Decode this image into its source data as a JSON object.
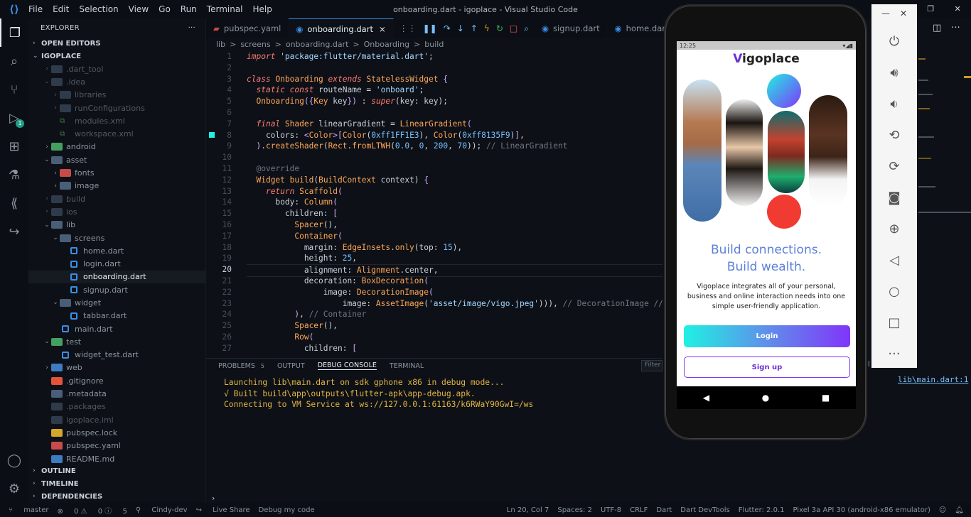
{
  "window": {
    "title": "onboarding.dart - igoplace - Visual Studio Code",
    "menu": [
      "File",
      "Edit",
      "Selection",
      "View",
      "Go",
      "Run",
      "Terminal",
      "Help"
    ]
  },
  "activity": {
    "debug_badge": "1"
  },
  "sidebar": {
    "header": "EXPLORER",
    "open_editors": "OPEN EDITORS",
    "root": "IGOPLACE",
    "items": [
      {
        "label": ".dart_tool",
        "depth": 1,
        "kind": "folder",
        "dim": true
      },
      {
        "label": ".idea",
        "depth": 1,
        "kind": "folder",
        "dim": true,
        "open": true
      },
      {
        "label": "libraries",
        "depth": 2,
        "kind": "folder",
        "dim": true
      },
      {
        "label": "runConfigurations",
        "depth": 2,
        "kind": "folder",
        "dim": true
      },
      {
        "label": "modules.xml",
        "depth": 2,
        "kind": "xml",
        "dim": true
      },
      {
        "label": "workspace.xml",
        "depth": 2,
        "kind": "xml",
        "dim": true
      },
      {
        "label": "android",
        "depth": 1,
        "kind": "folder-g"
      },
      {
        "label": "asset",
        "depth": 1,
        "kind": "folder",
        "open": true
      },
      {
        "label": "fonts",
        "depth": 2,
        "kind": "folder-r"
      },
      {
        "label": "image",
        "depth": 2,
        "kind": "folder"
      },
      {
        "label": "build",
        "depth": 1,
        "kind": "folder",
        "dim": true
      },
      {
        "label": "ios",
        "depth": 1,
        "kind": "folder",
        "dim": true
      },
      {
        "label": "lib",
        "depth": 1,
        "kind": "folder",
        "open": true
      },
      {
        "label": "screens",
        "depth": 2,
        "kind": "folder",
        "open": true
      },
      {
        "label": "home.dart",
        "depth": 3,
        "kind": "dart"
      },
      {
        "label": "login.dart",
        "depth": 3,
        "kind": "dart"
      },
      {
        "label": "onboarding.dart",
        "depth": 3,
        "kind": "dart",
        "selected": true
      },
      {
        "label": "signup.dart",
        "depth": 3,
        "kind": "dart"
      },
      {
        "label": "widget",
        "depth": 2,
        "kind": "folder",
        "open": true
      },
      {
        "label": "tabbar.dart",
        "depth": 3,
        "kind": "dart"
      },
      {
        "label": "main.dart",
        "depth": 2,
        "kind": "dart"
      },
      {
        "label": "test",
        "depth": 1,
        "kind": "folder-g",
        "open": true
      },
      {
        "label": "widget_test.dart",
        "depth": 2,
        "kind": "dart"
      },
      {
        "label": "web",
        "depth": 1,
        "kind": "folder-b"
      },
      {
        "label": ".gitignore",
        "depth": 1,
        "kind": "git"
      },
      {
        "label": ".metadata",
        "depth": 1,
        "kind": "file"
      },
      {
        "label": ".packages",
        "depth": 1,
        "kind": "file",
        "dim": true
      },
      {
        "label": "igoplace.iml",
        "depth": 1,
        "kind": "file",
        "dim": true
      },
      {
        "label": "pubspec.lock",
        "depth": 1,
        "kind": "lock"
      },
      {
        "label": "pubspec.yaml",
        "depth": 1,
        "kind": "yaml"
      },
      {
        "label": "README.md",
        "depth": 1,
        "kind": "md"
      }
    ],
    "outline": "OUTLINE",
    "timeline": "TIMELINE",
    "dependencies": "DEPENDENCIES"
  },
  "tabs": {
    "pubspec": "pubspec.yaml",
    "onboarding": "onboarding.dart",
    "signup": "signup.dart",
    "home": "home.dart"
  },
  "breadcrumb": [
    "lib",
    ">",
    "screens",
    ">",
    "onboarding.dart",
    ">",
    "Onboarding",
    ">",
    "build"
  ],
  "code": {
    "line_numbers": [
      "1",
      "2",
      "3",
      "4",
      "5",
      "6",
      "7",
      "8",
      "9",
      "10",
      "11",
      "12",
      "13",
      "14",
      "15",
      "16",
      "17",
      "18",
      "19",
      "20",
      "21",
      "22",
      "23",
      "24",
      "25",
      "26",
      "27"
    ]
  },
  "panel": {
    "tabs": [
      "PROBLEMS",
      "OUTPUT",
      "DEBUG CONSOLE",
      "TERMINAL"
    ],
    "problems_count": "5",
    "active_tab": "DEBUG CONSOLE",
    "filter_placeholder": "Filter (",
    "output": [
      "Launching lib\\main.dart on sdk gphone x86 in debug mode...",
      "√ Built build\\app\\outputs\\flutter-apk\\app-debug.apk.",
      "Connecting to VM Service at ws://127.0.0.1:61163/k6RWaY90GwI=/ws"
    ],
    "main_link": "lib\\main.dart:1"
  },
  "phone": {
    "time": "12:25",
    "logo_v": "V",
    "logo_rest": "igoplace",
    "headline_1": "Build connections.",
    "headline_2": "Build wealth.",
    "description": "Vigoplace integrates all of your personal, business and online interaction needs into one simple user-friendly application.",
    "login": "Login",
    "signup": "Sign up",
    "colors": {
      "gradient_start": "#1FF1E3",
      "gradient_end": "#8135F9",
      "red_circle": "#F03A32"
    }
  },
  "status": {
    "branch": "master",
    "errors": "0",
    "warnings": "0",
    "info": "5",
    "user": "Cindy-dev",
    "live_share": "Live Share",
    "debug": "Debug my code",
    "position": "Ln 20, Col 7",
    "spaces": "Spaces: 2",
    "encoding": "UTF-8",
    "eol": "CRLF",
    "lang": "Dart",
    "devtools": "Dart DevTools",
    "flutter": "Flutter: 2.0.1",
    "device": "Pixel 3a API 30 (android-x86 emulator)"
  }
}
